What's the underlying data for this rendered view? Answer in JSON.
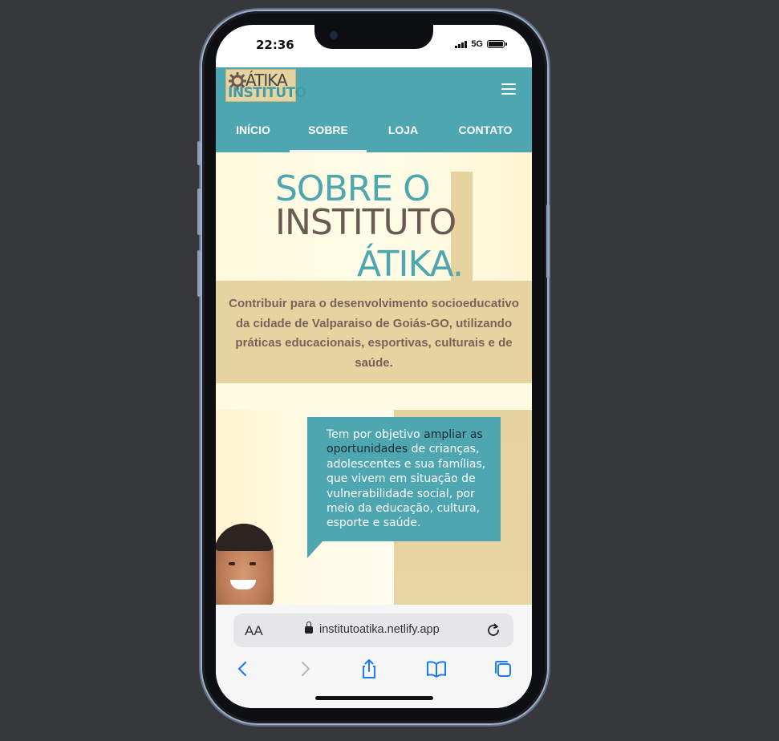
{
  "status_bar": {
    "time": "22:36",
    "network": "5G"
  },
  "site": {
    "logo": {
      "top_text": "ÁTIKA",
      "bottom_text": "INSTITUTO"
    },
    "nav": [
      {
        "label": "INÍCIO",
        "active": false
      },
      {
        "label": "SOBRE",
        "active": true
      },
      {
        "label": "LOJA",
        "active": false
      },
      {
        "label": "CONTATO",
        "active": false
      }
    ],
    "hero": {
      "line1": "SOBRE O",
      "line2": "INSTITUTO",
      "line3": "ÁTIKA."
    },
    "mission": "Contribuir para o desenvolvimento socioeducativo da cidade de Valparaiso de Goiás-GO, utilizando práticas educacionais, esportivas, culturais e de saúde.",
    "objective": {
      "before": "Tem por objetivo ",
      "highlight": "ampliar as oportunidades",
      "after": " de crianças, adolescentes e sua famílias, que vivem em situação de vulnerabilidade social, por meio da educação, cultura, esporte e saúde."
    }
  },
  "browser": {
    "text_size_label": "AA",
    "url": "institutoatika.netlify.app",
    "toolbar": [
      "back-icon",
      "forward-icon",
      "share-icon",
      "bookmarks-icon",
      "tabs-icon"
    ]
  },
  "colors": {
    "teal": "#4ea6b0",
    "sand": "#e7d3a0",
    "cream": "#fffbe0",
    "brown_text": "#77625a",
    "ios_blue": "#1a7cf5"
  }
}
